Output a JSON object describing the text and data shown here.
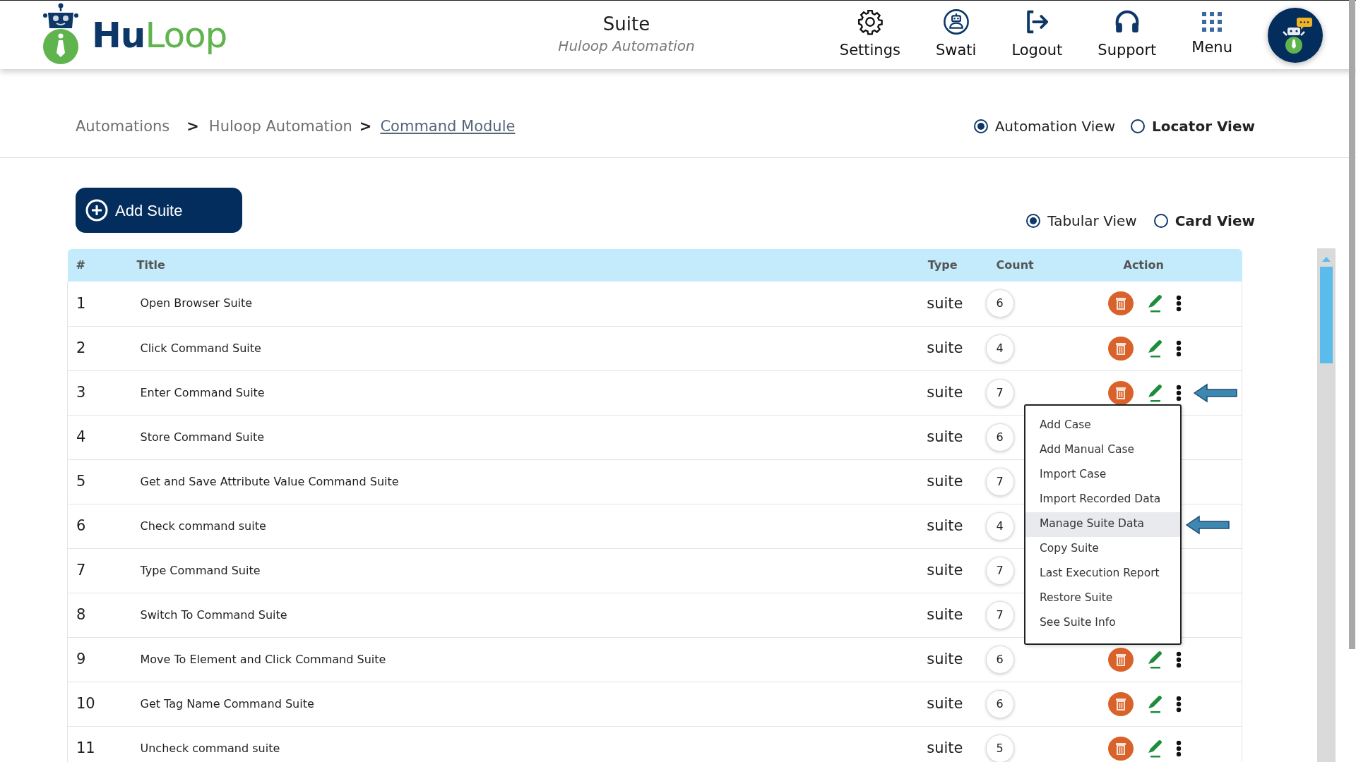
{
  "header": {
    "logo": "**Hu**Loop",
    "title": "Suite",
    "subtitle": "Huloop Automation",
    "nav": [
      {
        "label": "Settings"
      },
      {
        "label": "Swati"
      },
      {
        "label": "Logout"
      },
      {
        "label": "Support"
      },
      {
        "label": "Menu"
      }
    ]
  },
  "breadcrumb": [
    {
      "kind": "link",
      "label": "Automations",
      "current": false
    },
    {
      "kind": "separator",
      "label": ">"
    },
    {
      "kind": "link",
      "label": "Huloop Automation",
      "current": false
    },
    {
      "kind": "separator",
      "label": ">"
    },
    {
      "kind": "link",
      "label": "Command Module",
      "current": true
    }
  ],
  "view_modes": [
    {
      "label": "Automation View",
      "selected": true
    },
    {
      "label": "Locator View",
      "selected": false
    }
  ],
  "add_button": "Add Suite",
  "display_modes": [
    {
      "label": "Tabular View",
      "selected": true
    },
    {
      "label": "Card View",
      "selected": false
    }
  ],
  "table": {
    "columns": [
      "#",
      "Title",
      "Type",
      "Count",
      "Action"
    ],
    "rows": [
      {
        "index": "1",
        "title": "Open Browser Suite",
        "type": "suite",
        "count": "6",
        "menu_open": false
      },
      {
        "index": "2",
        "title": "Click Command Suite",
        "type": "suite",
        "count": "4",
        "menu_open": false
      },
      {
        "index": "3",
        "title": "Enter Command Suite",
        "type": "suite",
        "count": "7",
        "menu_open": true
      },
      {
        "index": "4",
        "title": "Store Command Suite",
        "type": "suite",
        "count": "6",
        "menu_open": false
      },
      {
        "index": "5",
        "title": "Get and Save Attribute Value Command Suite",
        "type": "suite",
        "count": "7",
        "menu_open": false
      },
      {
        "index": "6",
        "title": "Check command suite",
        "type": "suite",
        "count": "4",
        "menu_open": false
      },
      {
        "index": "7",
        "title": "Type Command Suite",
        "type": "suite",
        "count": "7",
        "menu_open": false
      },
      {
        "index": "8",
        "title": "Switch To Command Suite",
        "type": "suite",
        "count": "7",
        "menu_open": false
      },
      {
        "index": "9",
        "title": "Move To Element and Click Command Suite",
        "type": "suite",
        "count": "6",
        "menu_open": false
      },
      {
        "index": "10",
        "title": "Get Tag Name Command Suite",
        "type": "suite",
        "count": "6",
        "menu_open": false
      },
      {
        "index": "11",
        "title": "Uncheck command suite",
        "type": "suite",
        "count": "5",
        "menu_open": false
      }
    ]
  },
  "context_menu": [
    {
      "label": "Add Case",
      "selected": false
    },
    {
      "label": "Add Manual Case",
      "selected": false
    },
    {
      "label": "Import Case",
      "selected": false
    },
    {
      "label": "Import Recorded Data",
      "selected": false
    },
    {
      "label": "Manage Suite Data",
      "selected": true
    },
    {
      "label": "Copy Suite",
      "selected": false
    },
    {
      "label": "Last Execution Report",
      "selected": false
    },
    {
      "label": "Restore Suite",
      "selected": false
    },
    {
      "label": "See Suite Info",
      "selected": false
    }
  ]
}
